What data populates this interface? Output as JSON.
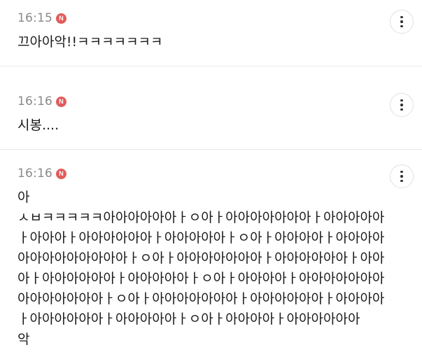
{
  "comments": [
    {
      "time": "16:15",
      "badge": "N",
      "text": "끄아아악!!ㅋㅋㅋㅋㅋㅋㅋ"
    },
    {
      "time": "16:16",
      "badge": "N",
      "text": "시봉...."
    },
    {
      "time": "16:16",
      "badge": "N",
      "text": "아\nㅅㅂㅋㅋㅋㅋㅋ아아아아아아ㅏㅇ아ㅏ아아아아아아아ㅏ아아아아아ㅏ아아아ㅏ아아아아아아ㅏ아아아아아ㅏㅇ아ㅏ아아아아ㅏ아아아아아아아아아아아아아ㅏㅇ아ㅏ아아아아아아아ㅏ아아아아아아ㅏ아아아ㅏ아아아아아아ㅏ아아아아아ㅏㅇ아ㅏ아아아아ㅏ아아아아아아아아아아아아아아ㅏㅇ아ㅏ아아아아아아아ㅏ아아아아아아ㅏ아아아아ㅏ아아아아아아ㅏ아아아아아ㅏㅇ아ㅏ아아아아ㅏ아아아아아아\n악"
    }
  ],
  "more_icon": "more-vertical-icon"
}
